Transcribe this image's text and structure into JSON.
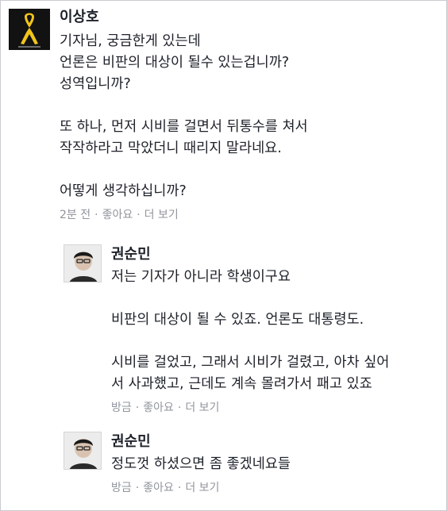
{
  "comments": [
    {
      "author": "이상호",
      "text": "기자님, 궁금한게 있는데\n언론은 비판의 대상이 될수 있는겁니까?\n성역입니까?\n\n또 하나, 먼저 시비를 걸면서 뒤통수를 쳐서\n작작하라고 막았더니 때리지 말라네요.\n\n어떻게 생각하십니까?",
      "time": "2분 전",
      "like": "좋아요",
      "more": "더 보기",
      "avatar_icon": "yellow-ribbon-icon"
    },
    {
      "author": "권순민",
      "text": "저는 기자가 아니라 학생이구요\n\n비판의 대상이 될 수 있죠. 언론도 대통령도.\n\n시비를 걸었고, 그래서 시비가 걸렸고, 아차 싶어\n서 사과했고, 근데도 계속 몰려가서 패고 있죠",
      "time": "방금",
      "like": "좋아요",
      "more": "더 보기",
      "avatar_icon": "person-photo-icon"
    },
    {
      "author": "권순민",
      "text": "정도껏 하셨으면 좀 좋겠네요들",
      "time": "방금",
      "like": "좋아요",
      "more": "더 보기",
      "avatar_icon": "person-photo-icon"
    }
  ],
  "separator": "·",
  "colors": {
    "text": "#1d2129",
    "meta": "#90949c",
    "ribbon": "#f2c51a",
    "avatar_dark": "#121212"
  }
}
